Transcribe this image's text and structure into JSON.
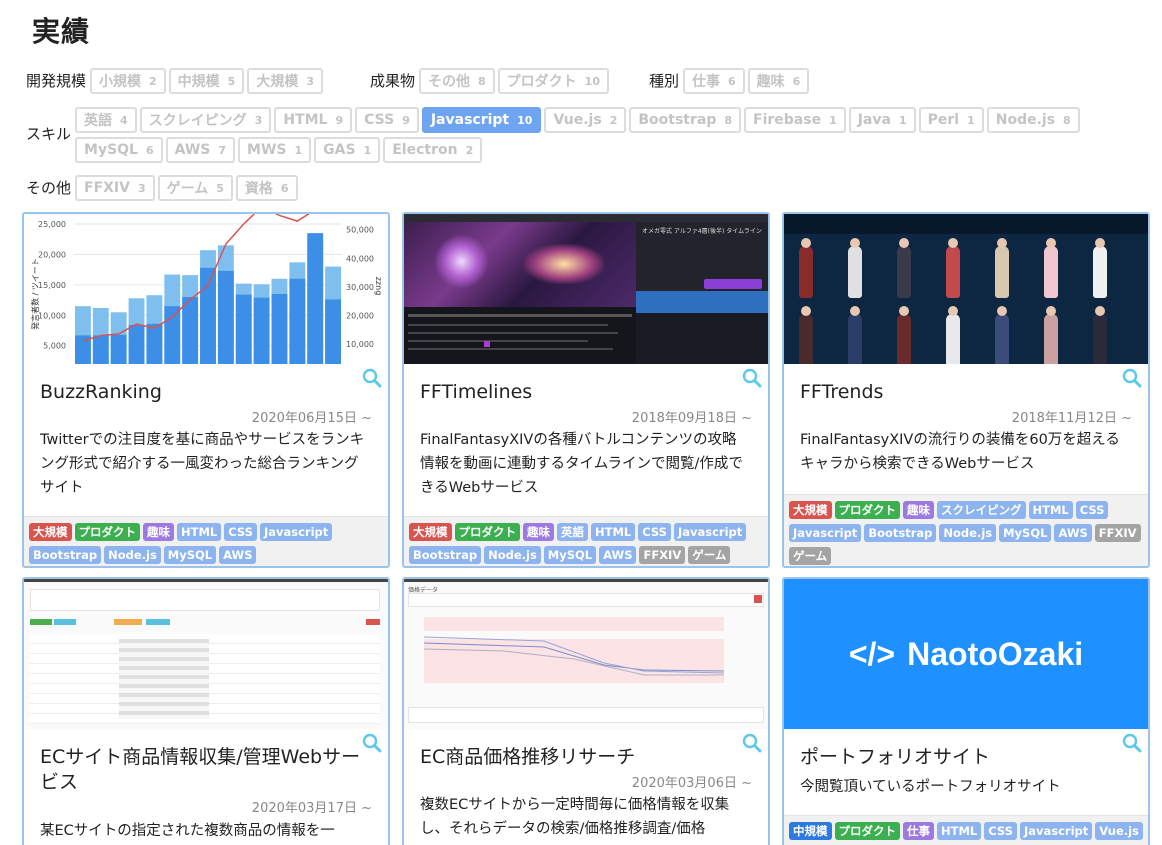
{
  "title": "実績",
  "filters": {
    "scale": {
      "label": "開発規模",
      "items": [
        {
          "name": "小規模",
          "count": "2"
        },
        {
          "name": "中規模",
          "count": "5"
        },
        {
          "name": "大規模",
          "count": "3"
        }
      ]
    },
    "deliverable": {
      "label": "成果物",
      "items": [
        {
          "name": "その他",
          "count": "8"
        },
        {
          "name": "プロダクト",
          "count": "10"
        }
      ]
    },
    "kind": {
      "label": "種別",
      "items": [
        {
          "name": "仕事",
          "count": "6"
        },
        {
          "name": "趣味",
          "count": "6"
        }
      ]
    },
    "skill": {
      "label": "スキル",
      "items": [
        {
          "name": "英語",
          "count": "4"
        },
        {
          "name": "スクレイピング",
          "count": "3"
        },
        {
          "name": "HTML",
          "count": "9"
        },
        {
          "name": "CSS",
          "count": "9"
        },
        {
          "name": "Javascript",
          "count": "10",
          "active": true
        },
        {
          "name": "Vue.js",
          "count": "2"
        },
        {
          "name": "Bootstrap",
          "count": "8"
        },
        {
          "name": "Firebase",
          "count": "1"
        },
        {
          "name": "Java",
          "count": "1"
        },
        {
          "name": "Perl",
          "count": "1"
        },
        {
          "name": "Node.js",
          "count": "8"
        },
        {
          "name": "MySQL",
          "count": "6"
        },
        {
          "name": "AWS",
          "count": "7"
        },
        {
          "name": "MWS",
          "count": "1"
        },
        {
          "name": "GAS",
          "count": "1"
        },
        {
          "name": "Electron",
          "count": "2"
        }
      ]
    },
    "other": {
      "label": "その他",
      "items": [
        {
          "name": "FFXIV",
          "count": "3"
        },
        {
          "name": "ゲーム",
          "count": "5"
        },
        {
          "name": "資格",
          "count": "6"
        }
      ]
    }
  },
  "cards": [
    {
      "title": "BuzzRanking",
      "date": "2020年06月15日 ~",
      "description": "Twitterでの注目度を基に商品やサービスをランキング形式で紹介する一風変わった総合ランキングサイト",
      "tags": [
        {
          "t": "大規模",
          "c": "red"
        },
        {
          "t": "プロダクト",
          "c": "green"
        },
        {
          "t": "趣味",
          "c": "purple"
        },
        {
          "t": "HTML",
          "c": "blue"
        },
        {
          "t": "CSS",
          "c": "blue"
        },
        {
          "t": "Javascript",
          "c": "blue"
        },
        {
          "t": "Bootstrap",
          "c": "blue"
        },
        {
          "t": "Node.js",
          "c": "blue"
        },
        {
          "t": "MySQL",
          "c": "blue"
        },
        {
          "t": "AWS",
          "c": "blue"
        }
      ],
      "thumb_chart": {
        "y_left_ticks": [
          "25,000",
          "20,000",
          "15,000",
          "10,000",
          "5,000"
        ],
        "y_right_ticks": [
          "50,000",
          "40,000",
          "30,000",
          "20,000",
          "10,000"
        ],
        "y_left_label": "発言者数 / ツイート",
        "y_right_label": "zzng",
        "bars_total": [
          11500,
          11200,
          10500,
          12800,
          13300,
          16700,
          16600,
          20700,
          21500,
          15200,
          15100,
          16000,
          18700,
          22500,
          18000
        ],
        "bars_inner": [
          6700,
          6700,
          6800,
          8400,
          8600,
          11500,
          13000,
          17800,
          17300,
          13400,
          12900,
          13500,
          16000,
          23500,
          12600
        ],
        "line": [
          11000,
          13000,
          13500,
          17000,
          15500,
          19500,
          25500,
          30500,
          45000,
          52000,
          58000,
          55000,
          53000,
          57000,
          58000
        ]
      }
    },
    {
      "title": "FFTimelines",
      "date": "2018年09月18日 ~",
      "description": "FinalFantasyXIVの各種バトルコンテンツの攻略情報を動画に連動するタイムラインで閲覧/作成できるWebサービス",
      "tags": [
        {
          "t": "大規模",
          "c": "red"
        },
        {
          "t": "プロダクト",
          "c": "green"
        },
        {
          "t": "趣味",
          "c": "purple"
        },
        {
          "t": "英語",
          "c": "blue"
        },
        {
          "t": "HTML",
          "c": "blue"
        },
        {
          "t": "CSS",
          "c": "blue"
        },
        {
          "t": "Javascript",
          "c": "blue"
        },
        {
          "t": "Bootstrap",
          "c": "blue"
        },
        {
          "t": "Node.js",
          "c": "blue"
        },
        {
          "t": "MySQL",
          "c": "blue"
        },
        {
          "t": "AWS",
          "c": "blue"
        },
        {
          "t": "FFXIV",
          "c": "grey"
        },
        {
          "t": "ゲーム",
          "c": "grey"
        }
      ],
      "thumb_text": "オメガ零式 アルファ4層(後半) タイムライン"
    },
    {
      "title": "FFTrends",
      "date": "2018年11月12日 ~",
      "description": "FinalFantasyXIVの流行りの装備を60万を超えるキャラから検索できるWebサービス",
      "tags": [
        {
          "t": "大規模",
          "c": "red"
        },
        {
          "t": "プロダクト",
          "c": "green"
        },
        {
          "t": "趣味",
          "c": "purple"
        },
        {
          "t": "スクレイピング",
          "c": "blue"
        },
        {
          "t": "HTML",
          "c": "blue"
        },
        {
          "t": "CSS",
          "c": "blue"
        },
        {
          "t": "Javascript",
          "c": "blue"
        },
        {
          "t": "Bootstrap",
          "c": "blue"
        },
        {
          "t": "Node.js",
          "c": "blue"
        },
        {
          "t": "MySQL",
          "c": "blue"
        },
        {
          "t": "AWS",
          "c": "blue"
        },
        {
          "t": "FFXIV",
          "c": "grey"
        },
        {
          "t": "ゲーム",
          "c": "grey"
        }
      ]
    },
    {
      "title": "ECサイト商品情報収集/管理Webサービス",
      "date": "2020年03月17日 ~",
      "description": "某ECサイトの指定された複数商品の情報を一",
      "tags": []
    },
    {
      "title": "EC商品価格推移リサーチ",
      "date": "2020年03月06日 ~",
      "description": "複数ECサイトから一定時間毎に価格情報を収集し、それらデータの検索/価格推移調査/価格",
      "tags": [],
      "thumb_text": "価格データ"
    },
    {
      "title": "ポートフォリオサイト",
      "date": "",
      "description": "今閲覧頂いているポートフォリオサイト",
      "tags": [
        {
          "t": "中規模",
          "c": "navy"
        },
        {
          "t": "プロダクト",
          "c": "green"
        },
        {
          "t": "仕事",
          "c": "purple"
        },
        {
          "t": "HTML",
          "c": "blue"
        },
        {
          "t": "CSS",
          "c": "blue"
        },
        {
          "t": "Javascript",
          "c": "blue"
        },
        {
          "t": "Vue.js",
          "c": "blue"
        }
      ],
      "logo_text": "NaotoOzaki"
    }
  ],
  "colors": {
    "accent": "#6fa5f0",
    "card_border": "#9cc4ea",
    "zoom": "#5cc9e6"
  }
}
